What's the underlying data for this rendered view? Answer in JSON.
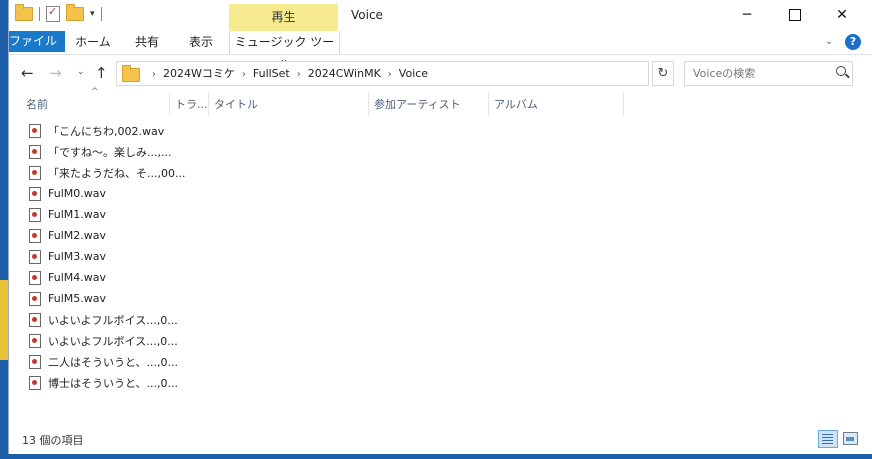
{
  "quick_access": {
    "folder_icon": "folder-icon",
    "properties_icon": "properties-icon",
    "new_folder_icon": "new-folder-icon",
    "dropdown_glyph": "▾"
  },
  "titlebar": {
    "context_tab_group": "再生",
    "title": "Voice",
    "minimize": "─",
    "close": "✕"
  },
  "ribbon": {
    "tabs": [
      "ファイル",
      "ホーム",
      "共有",
      "表示",
      "ミュージック ツール"
    ],
    "collapse_glyph": "⌄",
    "help": "?"
  },
  "nav": {
    "back": "←",
    "forward": "→",
    "recent": "⌄",
    "up": "↑",
    "address": [
      "2024Wコミケ",
      "FullSet",
      "2024CWinMK",
      "Voice"
    ],
    "separator": "›",
    "address_dropdown": "⌄",
    "refresh": "↻",
    "search_placeholder": "Voiceの検索"
  },
  "columns": [
    "名前",
    "トラ...",
    "タイトル",
    "参加アーティスト",
    "アルバム"
  ],
  "sort_glyph": "^",
  "files": [
    "「こんにちわ,002.wav",
    "「ですね～。楽しみ...,...",
    "「来たようだね、そ...,00...",
    "FulM0.wav",
    "FulM1.wav",
    "FulM2.wav",
    "FulM3.wav",
    "FulM4.wav",
    "FulM5.wav",
    "いよいよフルボイス...,0...",
    "いよいよフルボイス...,0...",
    "二人はそういうと、...,0...",
    "博士はそういうと、...,0..."
  ],
  "status": {
    "item_count": "13 個の項目"
  },
  "colors": {
    "file_tab": "#1979ca",
    "context_tab": "#f6eb8f",
    "desktop": "#1d5fa8"
  }
}
